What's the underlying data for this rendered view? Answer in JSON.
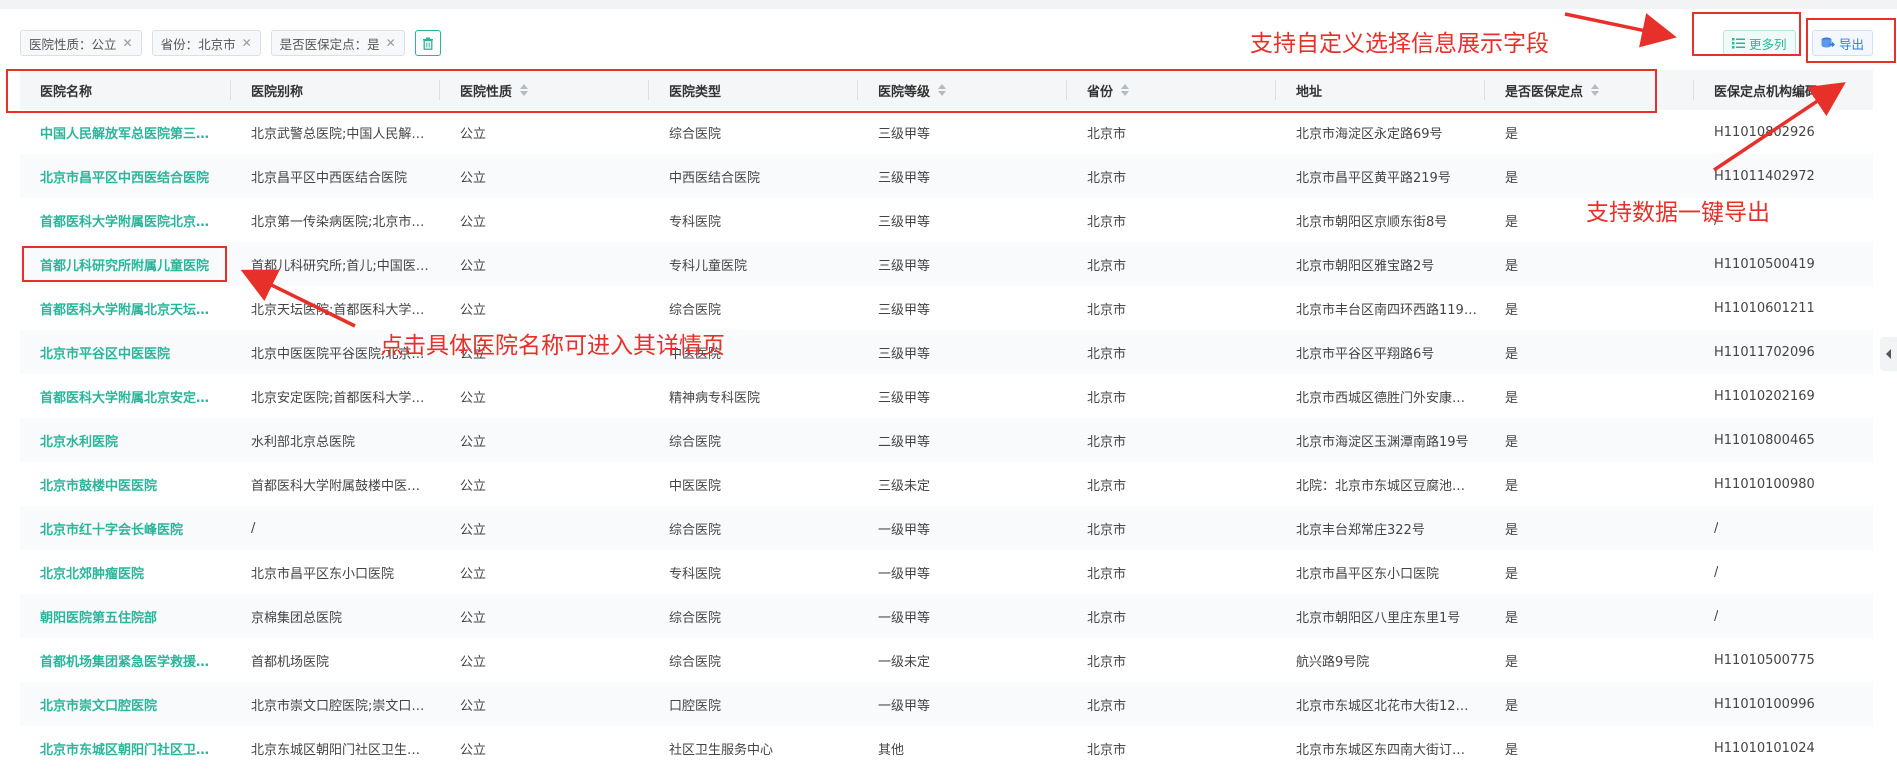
{
  "filters": [
    {
      "label": "医院性质：公立"
    },
    {
      "label": "省份：北京市"
    },
    {
      "label": "是否医保定点：是"
    }
  ],
  "toolbar": {
    "more_label": "更多列",
    "export_label": "导出"
  },
  "columns": [
    "医院名称",
    "医院别称",
    "医院性质",
    "医院类型",
    "医院等级",
    "省份",
    "地址",
    "是否医保定点",
    "医保定点机构编码"
  ],
  "sortable_columns": [
    "医院性质",
    "医院等级",
    "省份",
    "是否医保定点"
  ],
  "rows": [
    [
      "中国人民解放军总医院第三…",
      "北京武警总医院;中国人民解…",
      "公立",
      "综合医院",
      "三级甲等",
      "北京市",
      "北京市海淀区永定路69号",
      "是",
      "H11010802926"
    ],
    [
      "北京市昌平区中西医结合医院",
      "北京昌平区中西医结合医院",
      "公立",
      "中西医结合医院",
      "三级甲等",
      "北京市",
      "北京市昌平区黄平路219号",
      "是",
      "H11011402972"
    ],
    [
      "首都医科大学附属医院北京…",
      "北京第一传染病医院;北京市…",
      "公立",
      "专科医院",
      "三级甲等",
      "北京市",
      "北京市朝阳区京顺东街8号",
      "是",
      "/"
    ],
    [
      "首都儿科研究所附属儿童医院",
      "首都儿科研究所;首儿;中国医…",
      "公立",
      "专科儿童医院",
      "三级甲等",
      "北京市",
      "北京市朝阳区雅宝路2号",
      "是",
      "H11010500419"
    ],
    [
      "首都医科大学附属北京天坛…",
      "北京天坛医院;首都医科大学…",
      "公立",
      "综合医院",
      "三级甲等",
      "北京市",
      "北京市丰台区南四环西路119…",
      "是",
      "H11010601211"
    ],
    [
      "北京市平谷区中医医院",
      "北京中医医院平谷医院;北京…",
      "公立",
      "中医医院",
      "三级甲等",
      "北京市",
      "北京市平谷区平翔路6号",
      "是",
      "H11011702096"
    ],
    [
      "首都医科大学附属北京安定…",
      "北京安定医院;首都医科大学…",
      "公立",
      "精神病专科医院",
      "三级甲等",
      "北京市",
      "北京市西城区德胜门外安康…",
      "是",
      "H11010202169"
    ],
    [
      "北京水利医院",
      "水利部北京总医院",
      "公立",
      "综合医院",
      "二级甲等",
      "北京市",
      "北京市海淀区玉渊潭南路19号",
      "是",
      "H11010800465"
    ],
    [
      "北京市鼓楼中医医院",
      "首都医科大学附属鼓楼中医…",
      "公立",
      "中医医院",
      "三级未定",
      "北京市",
      "北院：北京市东城区豆腐池…",
      "是",
      "H11010100980"
    ],
    [
      "北京市红十字会长峰医院",
      "/",
      "公立",
      "综合医院",
      "一级甲等",
      "北京市",
      "北京丰台郑常庄322号",
      "是",
      "/"
    ],
    [
      "北京北郊肿瘤医院",
      "北京市昌平区东小口医院",
      "公立",
      "专科医院",
      "一级甲等",
      "北京市",
      "北京市昌平区东小口医院",
      "是",
      "/"
    ],
    [
      "朝阳医院第五住院部",
      "京棉集团总医院",
      "公立",
      "综合医院",
      "一级甲等",
      "北京市",
      "北京市朝阳区八里庄东里1号",
      "是",
      "/"
    ],
    [
      "首都机场集团紧急医学救援…",
      "首都机场医院",
      "公立",
      "综合医院",
      "一级未定",
      "北京市",
      "航兴路9号院",
      "是",
      "H11010500775"
    ],
    [
      "北京市崇文口腔医院",
      "北京市崇文口腔医院;崇文口…",
      "公立",
      "口腔医院",
      "一级甲等",
      "北京市",
      "北京市东城区北花市大街12…",
      "是",
      "H11010100996"
    ],
    [
      "北京市东城区朝阳门社区卫…",
      "北京东城区朝阳门社区卫生…",
      "公立",
      "社区卫生服务中心",
      "其他",
      "北京市",
      "北京市东城区东四南大街订…",
      "是",
      "H11010101024"
    ]
  ],
  "annotations": {
    "custom_fields": "支持自定义选择信息展示字段",
    "export_one_click": "支持数据一键导出",
    "click_name": "点击具体医院名称可进入其详情页"
  },
  "colors": {
    "accent": "#2bb59a",
    "annotation": "#e8302a",
    "export_blue": "#2f7de1"
  }
}
